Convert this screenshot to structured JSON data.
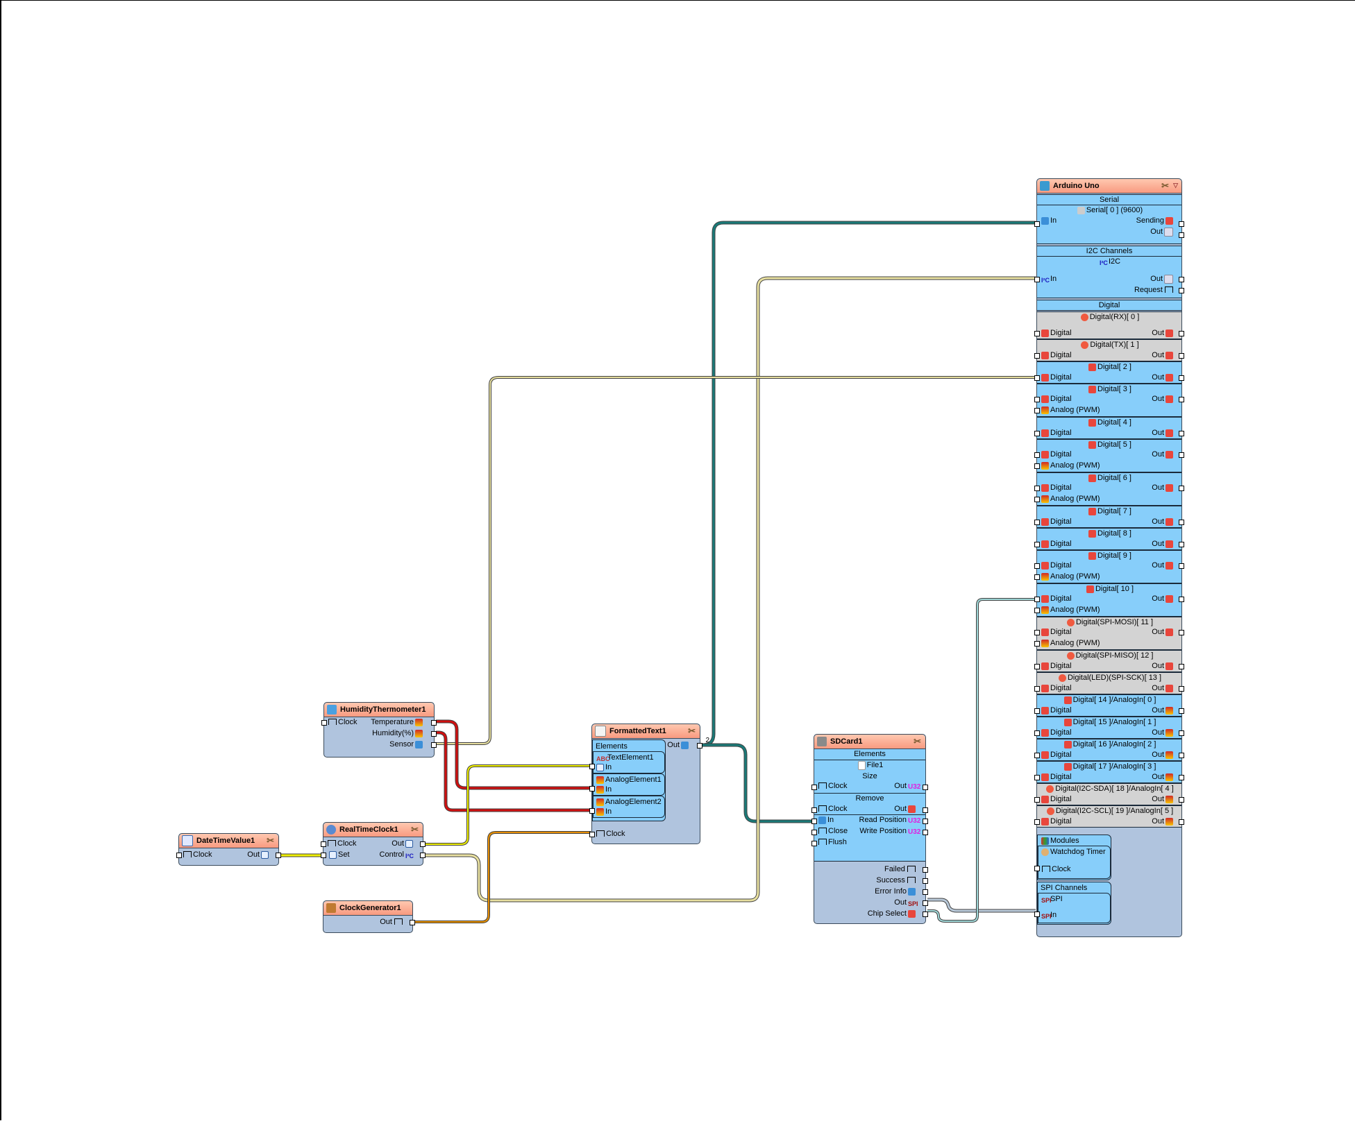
{
  "canvas": {
    "background": "#ffffff"
  },
  "colors": {
    "header": "#f89a80",
    "body": "#b0c4de",
    "section_active": "#87cefa",
    "section_disabled": "#d3d3d3",
    "wire_teal": "#1a7a78",
    "wire_khaki": "#e8e0a0",
    "wire_red": "#d01010",
    "wire_yellow": "#f0f000",
    "wire_orange": "#e89000",
    "wire_steel": "#b8c8d8",
    "wire_cyan": "#a0d8d8"
  },
  "components": {
    "humidity": {
      "title": "HumidityThermometer1",
      "pins_in": [
        "Clock"
      ],
      "pins_out": [
        "Temperature",
        "Humidity(%)",
        "Sensor"
      ]
    },
    "datetime": {
      "title": "DateTimeValue1",
      "pin_in": "Clock",
      "pin_out": "Out"
    },
    "rtc": {
      "title": "RealTimeClock1",
      "pins_in": [
        "Clock",
        "Set"
      ],
      "pins_out": [
        "Out",
        "Control"
      ]
    },
    "clockgen": {
      "title": "ClockGenerator1",
      "pin_out": "Out"
    },
    "formatted": {
      "title": "FormattedText1",
      "elements_label": "Elements",
      "out_label": "Out",
      "out_count": "2",
      "elements": [
        {
          "name": "TextElement1",
          "pin": "In"
        },
        {
          "name": "AnalogElement1",
          "pin": "In"
        },
        {
          "name": "AnalogElement2",
          "pin": "In"
        }
      ],
      "clock_label": "Clock"
    },
    "sdcard": {
      "title": "SDCard1",
      "elements_label": "Elements",
      "file": "File1",
      "size_label": "Size",
      "size_clock": "Clock",
      "size_out": "Out",
      "remove_label": "Remove",
      "remove_clock": "Clock",
      "remove_out": "Out",
      "in_label": "In",
      "close_label": "Close",
      "flush_label": "Flush",
      "read_pos": "Read Position",
      "write_pos": "Write Position",
      "failed": "Failed",
      "success": "Success",
      "error_info": "Error Info",
      "out": "Out",
      "chip_select": "Chip Select"
    },
    "arduino": {
      "title": "Arduino Uno",
      "serial_section": "Serial",
      "serial_name": "Serial[ 0 ] (9600)",
      "serial_in": "In",
      "serial_sending": "Sending",
      "serial_out": "Out",
      "i2c_section": "I2C Channels",
      "i2c_name": "I2C",
      "i2c_in": "In",
      "i2c_out": "Out",
      "i2c_request": "Request",
      "digital_section": "Digital",
      "digital_pins": [
        {
          "name": "Digital(RX)[ 0 ]",
          "disabled": true,
          "analog": false,
          "in": "Digital",
          "out": "Out"
        },
        {
          "name": "Digital(TX)[ 1 ]",
          "disabled": true,
          "analog": false,
          "in": "Digital",
          "out": "Out"
        },
        {
          "name": "Digital[ 2 ]",
          "disabled": false,
          "analog": false,
          "in": "Digital",
          "out": "Out"
        },
        {
          "name": "Digital[ 3 ]",
          "disabled": false,
          "analog": true,
          "in": "Digital",
          "out": "Out",
          "analog_label": "Analog (PWM)"
        },
        {
          "name": "Digital[ 4 ]",
          "disabled": false,
          "analog": false,
          "in": "Digital",
          "out": "Out"
        },
        {
          "name": "Digital[ 5 ]",
          "disabled": false,
          "analog": true,
          "in": "Digital",
          "out": "Out",
          "analog_label": "Analog (PWM)"
        },
        {
          "name": "Digital[ 6 ]",
          "disabled": false,
          "analog": true,
          "in": "Digital",
          "out": "Out",
          "analog_label": "Analog (PWM)"
        },
        {
          "name": "Digital[ 7 ]",
          "disabled": false,
          "analog": false,
          "in": "Digital",
          "out": "Out"
        },
        {
          "name": "Digital[ 8 ]",
          "disabled": false,
          "analog": false,
          "in": "Digital",
          "out": "Out"
        },
        {
          "name": "Digital[ 9 ]",
          "disabled": false,
          "analog": true,
          "in": "Digital",
          "out": "Out",
          "analog_label": "Analog (PWM)"
        },
        {
          "name": "Digital[ 10 ]",
          "disabled": false,
          "analog": true,
          "in": "Digital",
          "out": "Out",
          "analog_label": "Analog (PWM)"
        },
        {
          "name": "Digital(SPI-MOSI)[ 11 ]",
          "disabled": true,
          "analog": true,
          "in": "Digital",
          "out": "Out",
          "analog_label": "Analog (PWM)"
        },
        {
          "name": "Digital(SPI-MISO)[ 12 ]",
          "disabled": true,
          "analog": false,
          "in": "Digital",
          "out": "Out"
        },
        {
          "name": "Digital(LED)(SPI-SCK)[ 13 ]",
          "disabled": true,
          "analog": false,
          "in": "Digital",
          "out": "Out"
        },
        {
          "name": "Digital[ 14 ]/AnalogIn[ 0 ]",
          "disabled": false,
          "analog": false,
          "in": "Digital",
          "out": "Out"
        },
        {
          "name": "Digital[ 15 ]/AnalogIn[ 1 ]",
          "disabled": false,
          "analog": false,
          "in": "Digital",
          "out": "Out"
        },
        {
          "name": "Digital[ 16 ]/AnalogIn[ 2 ]",
          "disabled": false,
          "analog": false,
          "in": "Digital",
          "out": "Out"
        },
        {
          "name": "Digital[ 17 ]/AnalogIn[ 3 ]",
          "disabled": false,
          "analog": false,
          "in": "Digital",
          "out": "Out"
        },
        {
          "name": "Digital(I2C-SDA)[ 18 ]/AnalogIn[ 4 ]",
          "disabled": true,
          "analog": false,
          "in": "Digital",
          "out": "Out"
        },
        {
          "name": "Digital(I2C-SCL)[ 19 ]/AnalogIn[ 5 ]",
          "disabled": true,
          "analog": false,
          "in": "Digital",
          "out": "Out"
        }
      ],
      "modules_label": "Modules",
      "watchdog": "Watchdog Timer",
      "watchdog_clock": "Clock",
      "spi_section": "SPI Channels",
      "spi_name": "SPI",
      "spi_in": "In"
    }
  },
  "wires": [
    {
      "from": "FormattedText1.Out",
      "to": "Arduino.Serial.In",
      "color": "teal"
    },
    {
      "from": "FormattedText1.Out",
      "to": "SDCard1.In",
      "color": "teal"
    },
    {
      "from": "RealTimeClock1.Control",
      "to": "Arduino.I2C.In",
      "color": "khaki"
    },
    {
      "from": "HumidityThermometer1.Sensor",
      "to": "Arduino.Digital[2]",
      "color": "khaki"
    },
    {
      "from": "HumidityThermometer1.Temperature",
      "to": "FormattedText1.AnalogElement1.In",
      "color": "red"
    },
    {
      "from": "HumidityThermometer1.Humidity",
      "to": "FormattedText1.AnalogElement2.In",
      "color": "red"
    },
    {
      "from": "RealTimeClock1.Out",
      "to": "FormattedText1.TextElement1.In",
      "color": "yellow"
    },
    {
      "from": "DateTimeValue1.Out",
      "to": "RealTimeClock1.Set",
      "color": "yellow"
    },
    {
      "from": "ClockGenerator1.Out",
      "to": "FormattedText1.Clock",
      "color": "orange"
    },
    {
      "from": "SDCard1.Out",
      "to": "Arduino.SPI.In",
      "color": "steel"
    },
    {
      "from": "SDCard1.ChipSelect",
      "to": "Arduino.Digital[10]",
      "color": "cyan"
    }
  ]
}
